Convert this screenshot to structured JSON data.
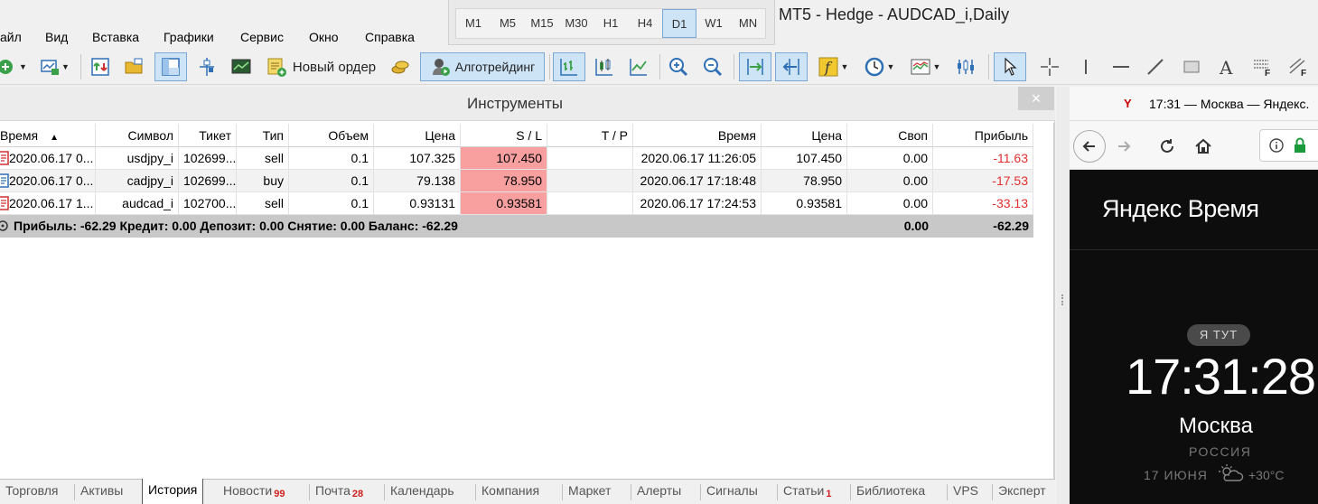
{
  "window": {
    "title": "MT5 - Hedge - AUDCAD_i,Daily"
  },
  "timeframes": {
    "items": [
      "M1",
      "M5",
      "M15",
      "M30",
      "H1",
      "H4",
      "D1",
      "W1",
      "MN"
    ],
    "active": "D1"
  },
  "menu": {
    "items": [
      "айл",
      "Вид",
      "Вставка",
      "Графики",
      "Сервис",
      "Окно",
      "Справка"
    ]
  },
  "toolbar": {
    "new_order_label": "Новый ордер",
    "algotrading_label": "Алготрейдинг"
  },
  "panel": {
    "title": "Инструменты",
    "close_label": "×"
  },
  "table": {
    "headers": {
      "time": "Время",
      "symbol": "Символ",
      "ticket": "Тикет",
      "type": "Тип",
      "volume": "Объем",
      "price": "Цена",
      "sl": "S / L",
      "tp": "T / P",
      "close_time": "Время",
      "close_price": "Цена",
      "swap": "Своп",
      "profit": "Прибыль"
    },
    "rows": [
      {
        "time": "2020.06.17 0...",
        "symbol": "usdjpy_i",
        "ticket": "102699...",
        "type": "sell",
        "volume": "0.1",
        "price": "107.325",
        "sl": "107.450",
        "tp": "",
        "close_time": "2020.06.17 11:26:05",
        "close_price": "107.450",
        "swap": "0.00",
        "profit": "-11.63",
        "dir": "sell"
      },
      {
        "time": "2020.06.17 0...",
        "symbol": "cadjpy_i",
        "ticket": "102699...",
        "type": "buy",
        "volume": "0.1",
        "price": "79.138",
        "sl": "78.950",
        "tp": "",
        "close_time": "2020.06.17 17:18:48",
        "close_price": "78.950",
        "swap": "0.00",
        "profit": "-17.53",
        "dir": "buy"
      },
      {
        "time": "2020.06.17 1...",
        "symbol": "audcad_i",
        "ticket": "102700...",
        "type": "sell",
        "volume": "0.1",
        "price": "0.93131",
        "sl": "0.93581",
        "tp": "",
        "close_time": "2020.06.17 17:24:53",
        "close_price": "0.93581",
        "swap": "0.00",
        "profit": "-33.13",
        "dir": "sell"
      }
    ],
    "summary": {
      "text": "Прибыль: -62.29  Кредит: 0.00  Депозит: 0.00  Снятие: 0.00  Баланс: -62.29",
      "swap": "0.00",
      "profit": "-62.29"
    }
  },
  "tabs": [
    {
      "label": "Торговля",
      "badge": ""
    },
    {
      "label": "Активы",
      "badge": ""
    },
    {
      "label": "История",
      "badge": "",
      "active": true
    },
    {
      "label": "Новости",
      "badge": "99"
    },
    {
      "label": "Почта",
      "badge": "28"
    },
    {
      "label": "Календарь",
      "badge": ""
    },
    {
      "label": "Компания",
      "badge": ""
    },
    {
      "label": "Маркет",
      "badge": ""
    },
    {
      "label": "Алерты",
      "badge": ""
    },
    {
      "label": "Сигналы",
      "badge": ""
    },
    {
      "label": "Статьи",
      "badge": "1"
    },
    {
      "label": "Библиотека",
      "badge": ""
    },
    {
      "label": "VPS",
      "badge": ""
    },
    {
      "label": "Эксперт",
      "badge": ""
    }
  ],
  "browser": {
    "tab_title": "17:31 — Москва — Яндекс.",
    "logo": "Яндекс Время",
    "here_pill": "Я ТУТ",
    "time": "17:31:28",
    "city": "Москва",
    "country": "РОССИЯ",
    "date": "17 ИЮНЯ",
    "temperature": "+30°C"
  },
  "colors": {
    "sl_highlight": "#f8a0a0",
    "negative_profit": "#e03030",
    "accent_pressed": "#cde4f7",
    "badge": "#d02020"
  }
}
